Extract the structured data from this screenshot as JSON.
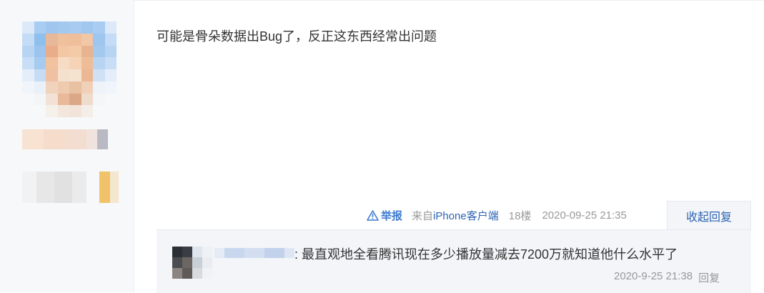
{
  "post": {
    "content": "可能是骨朵数据出Bug了，反正这东西经常出问题"
  },
  "meta": {
    "report_label": "举报",
    "source_prefix": "来自",
    "source_device": "iPhone客户端",
    "floor": "18楼",
    "timestamp": "2020-09-25 21:35",
    "collapse_label": "收起回复"
  },
  "reply": {
    "separator": ":",
    "content": "最直观地全看腾讯现在多少播放量减去7200万就知道他什么水平了",
    "timestamp": "2020-9-25 21:38",
    "reply_label": "回复"
  },
  "colors": {
    "link_blue": "#2d64b3",
    "report_blue": "#3d7bd0",
    "text_main": "#333333",
    "text_muted": "#999999",
    "reply_bg": "#f3f5f8"
  },
  "icons": {
    "report": "warning-triangle-icon"
  }
}
